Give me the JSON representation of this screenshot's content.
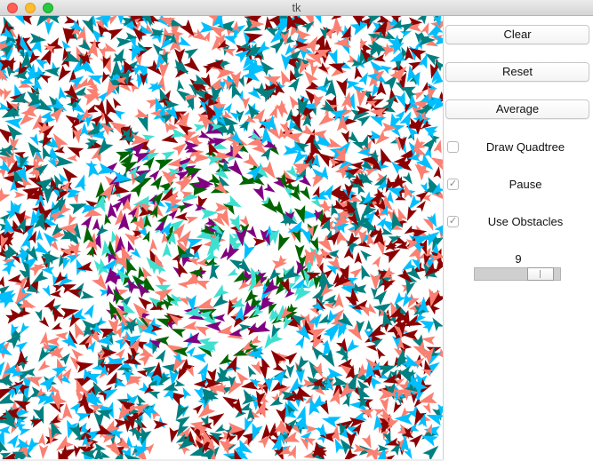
{
  "window": {
    "title": "tk"
  },
  "controls": {
    "clear_label": "Clear",
    "reset_label": "Reset",
    "average_label": "Average",
    "draw_quadtree": {
      "label": "Draw Quadtree",
      "checked": false
    },
    "pause": {
      "label": "Pause",
      "checked": true
    },
    "use_obstacles": {
      "label": "Use Obstacles",
      "checked": true
    },
    "scale": {
      "value": "9",
      "min": 0,
      "max": 10
    }
  },
  "colors": {
    "outer": [
      "#8b0000",
      "#fa8072",
      "#00bfff",
      "#008080"
    ],
    "inner": [
      "#800080",
      "#006400",
      "#40e0d0",
      "#fa8072"
    ]
  }
}
